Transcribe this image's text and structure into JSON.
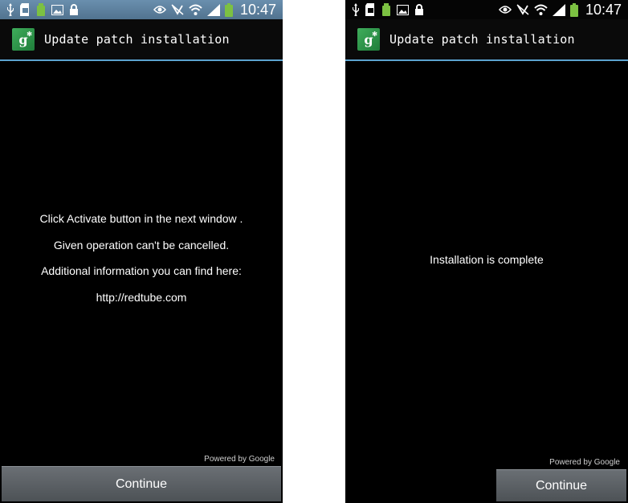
{
  "status_bar": {
    "time": "10:47",
    "icons_left": [
      "usb-icon",
      "sd-card-icon",
      "android-icon",
      "image-icon",
      "lock-icon"
    ],
    "icons_right": [
      "eye-icon",
      "mute-icon",
      "wifi-icon",
      "signal-icon",
      "battery-icon"
    ]
  },
  "colors": {
    "accent_line": "#5ba3cf",
    "status_bar_left": "#5d819f",
    "status_icon_green": "#7cc142",
    "button_bg": "#5c6166"
  },
  "screen_left": {
    "title": "Update patch installation",
    "message": [
      "Click Activate button in the next window .",
      "Given operation can't be cancelled.",
      "Additional information you can find here:",
      "http://redtube.com"
    ],
    "powered_by": "Powered by Google",
    "continue_label": "Continue"
  },
  "screen_right": {
    "title": "Update patch installation",
    "message": "Installation is complete",
    "powered_by": "Powered by Google",
    "continue_label": "Continue"
  }
}
